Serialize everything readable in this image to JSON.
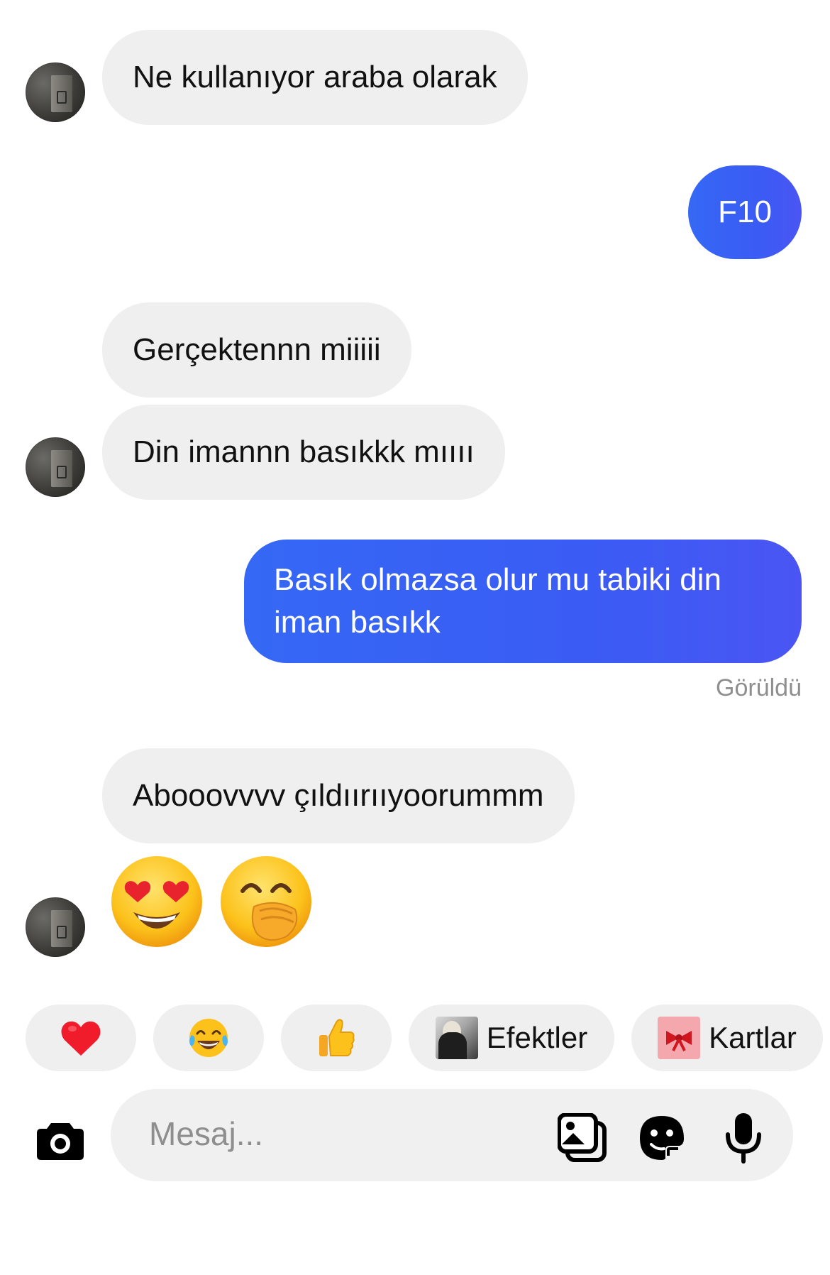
{
  "messages": [
    {
      "direction": "incoming",
      "text": "Ne kullanıyor araba olarak"
    },
    {
      "direction": "outgoing",
      "text": "F10"
    },
    {
      "direction": "incoming",
      "text": "Gerçektennn miiiii"
    },
    {
      "direction": "incoming",
      "text": "Din imannn basıkkk mıııı"
    },
    {
      "direction": "outgoing",
      "text": "Basık olmazsa olur mu tabiki din iman basıkk"
    },
    {
      "direction": "incoming",
      "text": "Abooovvvv çıldıırııyoorummm"
    },
    {
      "direction": "incoming",
      "emojis": [
        "heart-eyes-emoji",
        "hand-over-mouth-emoji"
      ]
    }
  ],
  "seen_status": "Görüldü",
  "quick_reactions": {
    "heart": "heart-icon",
    "laughing": "tears-of-joy-icon",
    "thumbs_up": "thumbs-up-icon",
    "effects_label": "Efektler",
    "cards_label": "Kartlar"
  },
  "composer": {
    "placeholder": "Mesaj..."
  },
  "colors": {
    "outgoing_bubble": "#3568f5",
    "incoming_bubble": "#efefef",
    "background": "#ffffff",
    "seen_text": "#8e8e8e"
  }
}
